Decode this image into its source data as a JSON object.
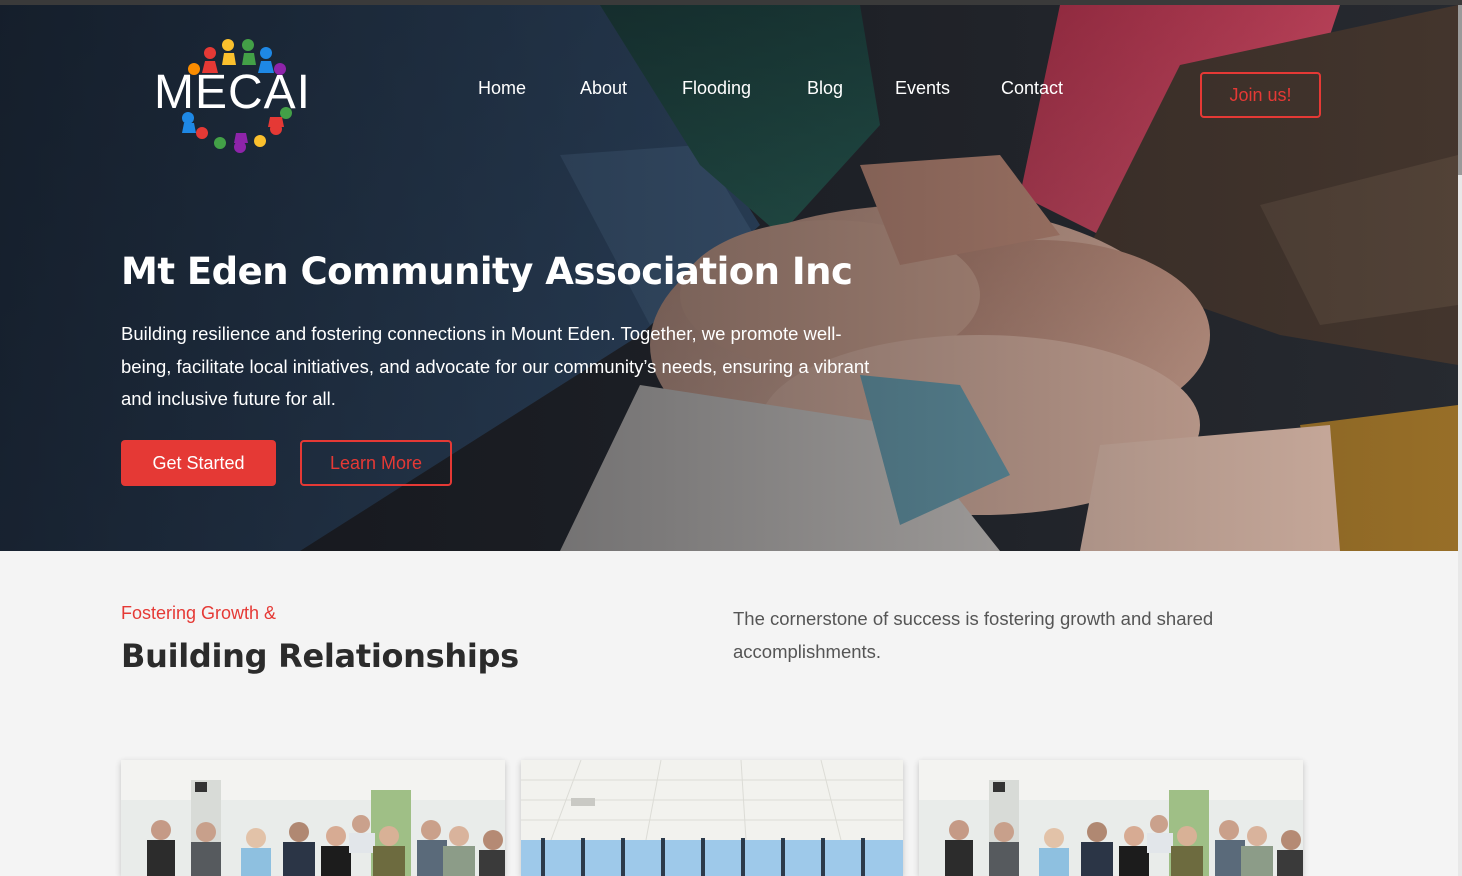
{
  "brand": {
    "name": "MECAI",
    "logo_icon": "globe-of-people-icon"
  },
  "nav": {
    "items": [
      {
        "label": "Home"
      },
      {
        "label": "About"
      },
      {
        "label": "Flooding"
      },
      {
        "label": "Blog"
      },
      {
        "label": "Events"
      },
      {
        "label": "Contact"
      }
    ],
    "cta_label": "Join us!"
  },
  "hero": {
    "title": "Mt Eden Community Association Inc",
    "description": "Building resilience and fostering connections in Mount Eden. Together, we promote well-being, facilitate local initiatives, and advocate for our community’s needs, ensuring a vibrant and inclusive future for all.",
    "primary_button": "Get Started",
    "secondary_button": "Learn More",
    "image_subject": "hands stacked together"
  },
  "section": {
    "eyebrow": "Fostering Growth &",
    "title": "Building Relationships",
    "description": "The cornerstone of success is fostering growth and shared accomplishments."
  },
  "cards": [
    {
      "image_subject": "group photo of community members"
    },
    {
      "image_subject": "meeting room with windows"
    },
    {
      "image_subject": "group photo of community members"
    }
  ],
  "colors": {
    "accent": "#e53935",
    "background": "#f4f4f4",
    "heading": "#2b2b2b"
  }
}
